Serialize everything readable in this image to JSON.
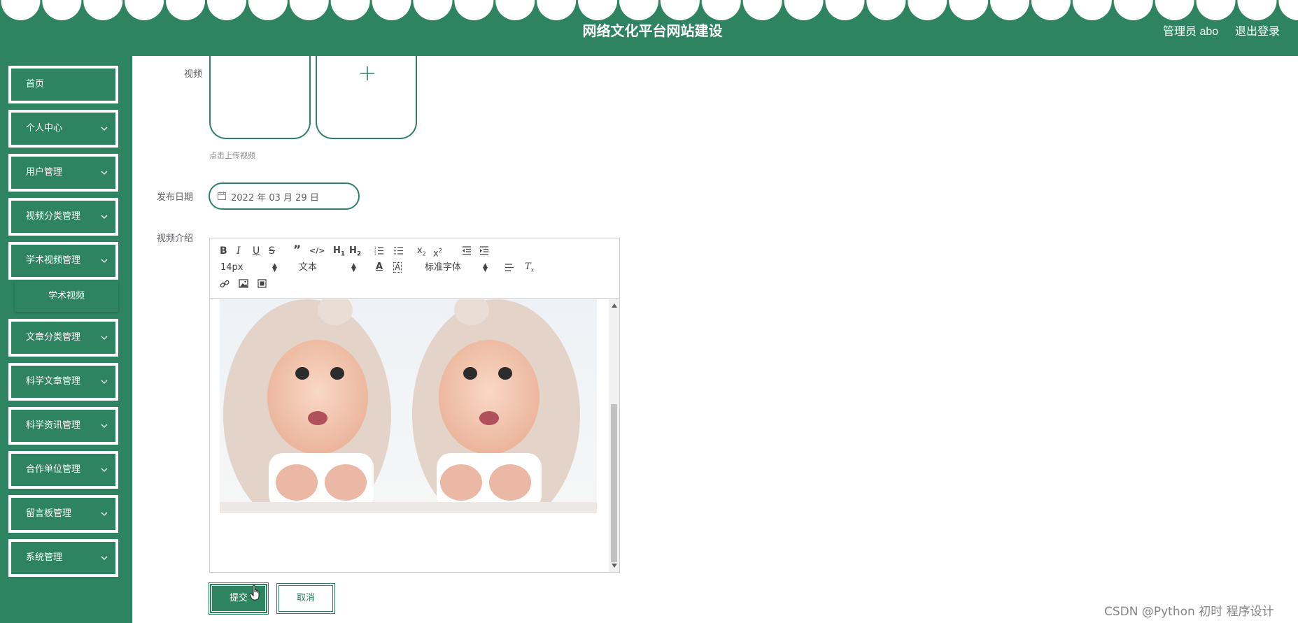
{
  "header": {
    "title": "网络文化平台网站建设",
    "admin_label": "管理员 abo",
    "logout_label": "退出登录"
  },
  "sidebar": {
    "items": [
      {
        "label": "首页",
        "has_chevron": false
      },
      {
        "label": "个人中心",
        "has_chevron": true
      },
      {
        "label": "用户管理",
        "has_chevron": true
      },
      {
        "label": "视频分类管理",
        "has_chevron": true
      },
      {
        "label": "学术视频管理",
        "has_chevron": true
      },
      {
        "label": "文章分类管理",
        "has_chevron": true
      },
      {
        "label": "科学文章管理",
        "has_chevron": true
      },
      {
        "label": "科学资讯管理",
        "has_chevron": true
      },
      {
        "label": "合作单位管理",
        "has_chevron": true
      },
      {
        "label": "留言板管理",
        "has_chevron": true
      },
      {
        "label": "系统管理",
        "has_chevron": true
      }
    ],
    "submenu": {
      "label": "学术视频"
    }
  },
  "form": {
    "video_label": "视频",
    "upload_tip": "点击上传视频",
    "date_label": "发布日期",
    "date_value": "2022 年 03 月 29 日",
    "intro_label": "视频介绍"
  },
  "editor": {
    "font_size": "14px",
    "text_type": "文本",
    "font_family": "标准字体",
    "image_icon": "two-babies-photo-icon"
  },
  "buttons": {
    "submit": "提交",
    "cancel": "取消"
  },
  "watermark": "CSDN @Python 初时 程序设计",
  "colors": {
    "primary": "#2e8460",
    "white": "#ffffff"
  }
}
